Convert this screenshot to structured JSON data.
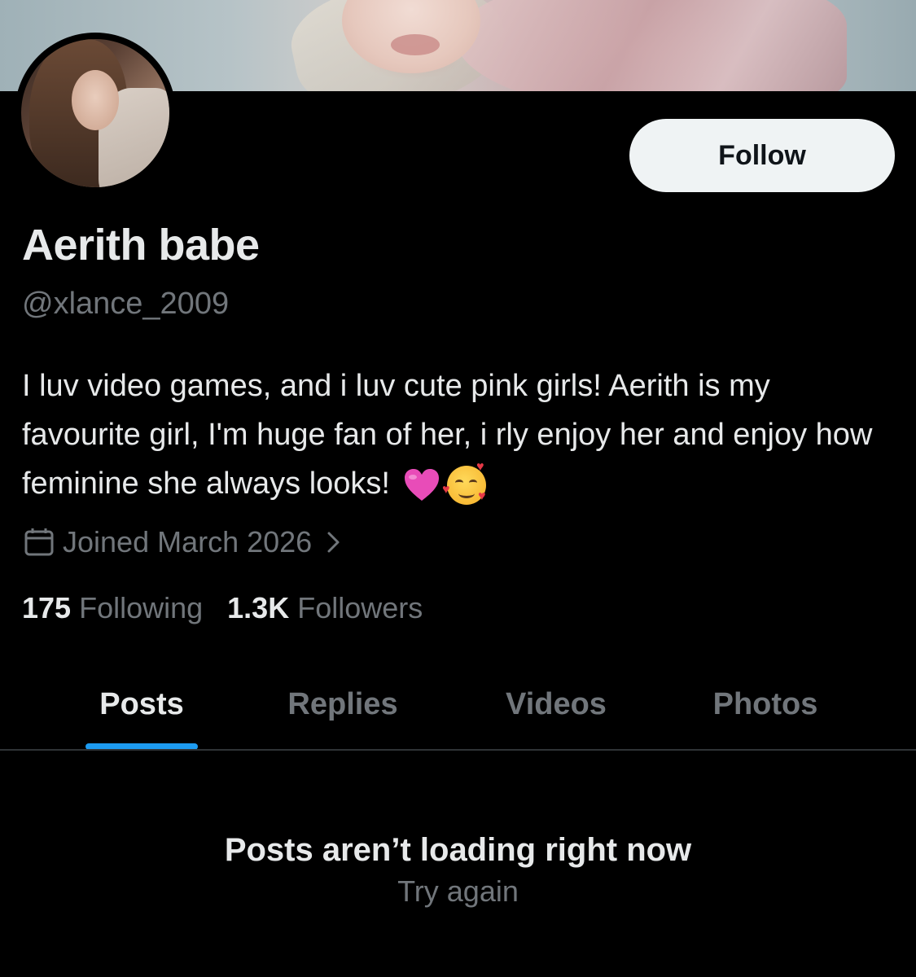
{
  "profile": {
    "display_name": "Aerith babe",
    "handle": "@xlance_2009",
    "bio": "I luv video games, and i luv cute pink girls! Aerith is my favourite girl, I'm huge fan of her, i rly enjoy her and enjoy how feminine she always looks!",
    "bio_emojis": [
      "pink-heart-icon",
      "smiling-face-with-hearts-icon"
    ],
    "joined": "Joined March 2026",
    "following_count": "175",
    "following_label": "Following",
    "followers_count": "1.3K",
    "followers_label": "Followers"
  },
  "actions": {
    "follow_label": "Follow"
  },
  "tabs": [
    {
      "label": "Posts",
      "active": true
    },
    {
      "label": "Replies",
      "active": false
    },
    {
      "label": "Videos",
      "active": false
    },
    {
      "label": "Photos",
      "active": false
    }
  ],
  "feed": {
    "error_title": "Posts aren’t loading right now",
    "retry_label": "Try again"
  },
  "colors": {
    "background": "#000000",
    "primary_text": "#e7e9ea",
    "secondary_text": "#71767b",
    "accent": "#1d9bf0",
    "follow_button_bg": "#eff3f4"
  }
}
